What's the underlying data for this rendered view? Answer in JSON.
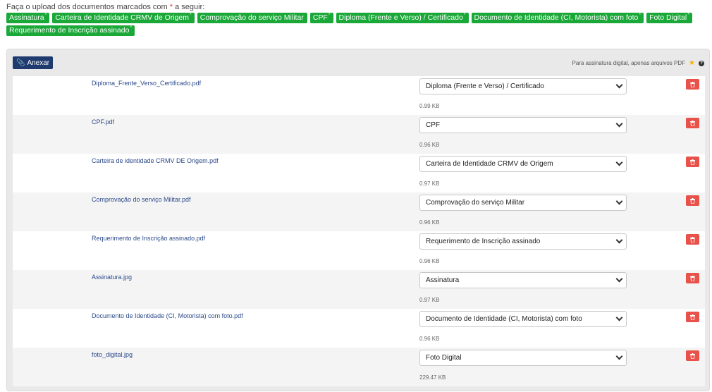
{
  "intro": {
    "before": "Faça o upload dos documentos marcados com ",
    "star": "*",
    "after": " a seguir:"
  },
  "tags": [
    {
      "label": "Assinatura",
      "mark": "*"
    },
    {
      "label": "Carteira de Identidade CRMV de Origem",
      "mark": "*"
    },
    {
      "label": "Comprovação do serviço Militar",
      "mark": ""
    },
    {
      "label": "CPF",
      "mark": "*"
    },
    {
      "label": "Diploma (Frente e Verso) / Certificado",
      "mark": "*"
    },
    {
      "label": "Documento de Identidade (CI, Motorista) com foto",
      "mark": "*"
    },
    {
      "label": "Foto Digital",
      "mark": "*"
    },
    {
      "label": "Requerimento de Inscrição assinado",
      "mark": "*"
    }
  ],
  "toolbar": {
    "attach_label": "Anexar",
    "note": "Para assinatura digital, apenas arquivos PDF",
    "help": "?"
  },
  "files": [
    {
      "name": "Diploma_Frente_Verso_Certificado.pdf",
      "type": "Diploma (Frente e Verso) / Certificado",
      "size": "0.99 KB"
    },
    {
      "name": "CPF.pdf",
      "type": "CPF",
      "size": "0.96 KB"
    },
    {
      "name": "Carteira de identidade CRMV DE Origem.pdf",
      "type": "Carteira de Identidade CRMV de Origem",
      "size": "0.97 KB"
    },
    {
      "name": "Comprovação do serviço Militar.pdf",
      "type": "Comprovação do serviço Militar",
      "size": "0.96 KB"
    },
    {
      "name": "Requerimento de Inscrição assinado.pdf",
      "type": "Requerimento de Inscrição assinado",
      "size": "0.96 KB"
    },
    {
      "name": "Assinatura.jpg",
      "type": "Assinatura",
      "size": "0.97 KB"
    },
    {
      "name": "Documento de Identidade (CI, Motorista) com foto.pdf",
      "type": "Documento de Identidade (CI, Motorista) com foto",
      "size": "0.96 KB"
    },
    {
      "name": "foto_digital.jpg",
      "type": "Foto Digital",
      "size": "229.47 KB"
    }
  ],
  "colors": {
    "tag_bg": "#1aa838",
    "attach_bg": "#1e3a6e",
    "delete_bg": "#e8524a",
    "link": "#2c4a8a",
    "star": "#f5b400"
  }
}
